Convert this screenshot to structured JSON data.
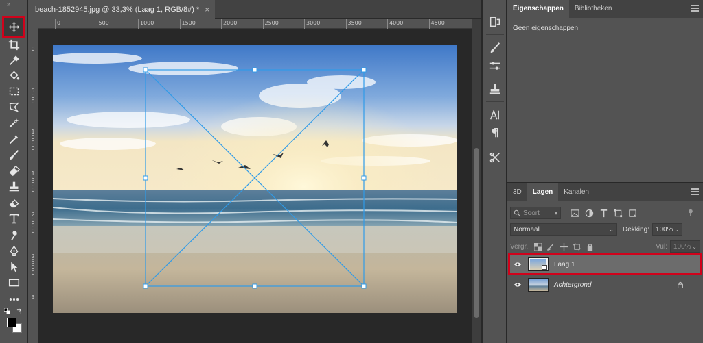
{
  "document": {
    "tab_title": "beach-1852945.jpg @ 33,3% (Laag 1, RGB/8#) *",
    "close_glyph": "×"
  },
  "rulers": {
    "horizontal": [
      "0",
      "500",
      "1000",
      "1500",
      "2000",
      "2500",
      "3000",
      "3500",
      "4000",
      "4500"
    ],
    "vertical": [
      "0",
      "500",
      "1000",
      "1500",
      "2000",
      "2500",
      "3"
    ]
  },
  "toolbar": {
    "collapse_glyph": "»",
    "tools": [
      "move-icon",
      "crop-icon",
      "eyedropper-icon",
      "paint-bucket-icon",
      "marquee-icon",
      "lasso-icon",
      "magic-wand-icon",
      "healing-brush-icon",
      "brush-icon",
      "eraser-fill-icon",
      "clone-stamp-icon",
      "eraser-icon",
      "type-icon",
      "smudge-icon",
      "pen-icon",
      "path-selection-icon",
      "rectangle-icon",
      "more-tools-icon"
    ],
    "active_tool": "move-icon"
  },
  "properties_panel": {
    "tabs": [
      "Eigenschappen",
      "Bibliotheken"
    ],
    "active_tab": "Eigenschappen",
    "empty_text": "Geen eigenschappen"
  },
  "layers_panel": {
    "tabs": [
      "3D",
      "Lagen",
      "Kanalen"
    ],
    "active_tab": "Lagen",
    "filter_placeholder": "Soort",
    "blend_mode": "Normaal",
    "opacity_label": "Dekking:",
    "opacity_value": "100%",
    "lock_label": "Vergr.:",
    "fill_label": "Vul:",
    "fill_value": "100%",
    "layers": [
      {
        "name": "Laag 1",
        "selected": true,
        "italic": false
      },
      {
        "name": "Achtergrond",
        "selected": false,
        "italic": true
      }
    ]
  },
  "colors": {
    "accent_highlight": "#d0021b",
    "transform_box": "#2f9be8"
  }
}
